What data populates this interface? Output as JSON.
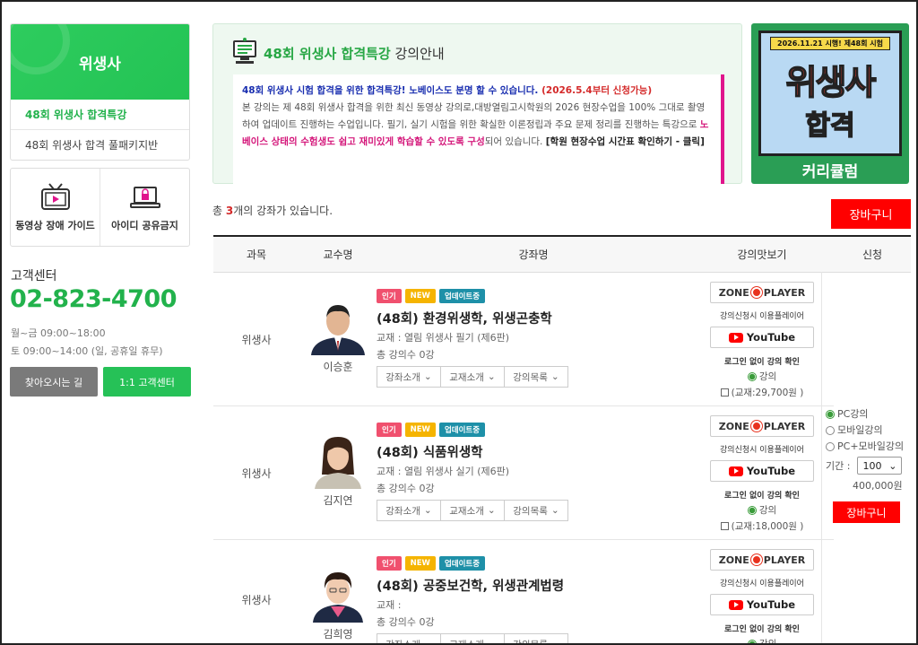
{
  "sidebar": {
    "title": "위생사",
    "links": [
      "48회 위생사 합격특강",
      "48회 위생사 합격 풀패키지반"
    ],
    "guides": [
      "동영상 장애 가이드",
      "아이디 공유금지"
    ]
  },
  "customer_center": {
    "title": "고객센터",
    "phone": "02-823-4700",
    "hours_weekday": "월~금 09:00~18:00",
    "hours_saturday": "토 09:00~14:00 (일, 공휴일 휴무)",
    "btn_directions": "찾아오시는 길",
    "btn_1on1": "1:1 고객센터"
  },
  "notice": {
    "title_green": "48회 위생사 합격특강",
    "title_rest": " 강의안내",
    "line_blue": "48회 위생사 시험 합격을 위한 합격특강! 노베이스도 분명 할 수 있습니다.",
    "line_red": " (2026.5.4부터 신청가능)",
    "body_1": "본 강의는 제 48회 위생사 합격을 위한 최신 동영상 강의로,대방열림고시학원의 2026 현장수업을 100% 그대로 촬영하여 업데이트 진행하는 수업입니다. 필기, 실기 시험을 위한 확실한 이론정립과 주요 문제 정리를 진행하는 특강으로 ",
    "body_pink": "노베이스 상태의 수험생도 쉽고 재미있게 학습할 수 있도록 구성",
    "body_2": "되어 있습니다. ",
    "body_link": "[학원 현장수업 시간표 확인하기 - 클릭]"
  },
  "banner": {
    "date": "2026.11.21 시행! 제48회 시험",
    "title": "위생사",
    "subtitle": "합격",
    "footer": "커리큘럼"
  },
  "listing": {
    "count_prefix": "총 ",
    "count": "3",
    "count_suffix": "개의 강좌가 있습니다.",
    "cart_label": "장바구니"
  },
  "table": {
    "headers": [
      "과목",
      "교수명",
      "강좌명",
      "강의맛보기",
      "신청"
    ]
  },
  "common": {
    "badges": [
      "인기",
      "NEW",
      "업데이트중"
    ],
    "mini_buttons": [
      "강좌소개",
      "교재소개",
      "강의목록"
    ],
    "zone_player": "ZONE",
    "zone_player2": "PLAYER",
    "player_note": "강의신청시 이용플레이어",
    "youtube": "YouTube",
    "login_note": "로그인 없이 강의 확인",
    "radio_label": "강의",
    "total_label": "총 강의수 0강"
  },
  "courses": [
    {
      "subject": "위생사",
      "professor": "이승훈",
      "title": "(48회) 환경위생학, 위생곤충학",
      "book": "교재 : 열림 위생사 필기 (제6판)",
      "book_price": "(교재:29,700원 )"
    },
    {
      "subject": "위생사",
      "professor": "김지연",
      "title": "(48회) 식품위생학",
      "book": "교재 : 열림 위생사 실기 (제6판)",
      "book_price": "(교재:18,000원 )"
    },
    {
      "subject": "위생사",
      "professor": "김희영",
      "title": "(48회) 공중보건학, 위생관계법령",
      "book": "교재 :",
      "book_price": ""
    }
  ],
  "apply": {
    "options": [
      "PC강의",
      "모바일강의",
      "PC+모바일강의"
    ],
    "period_label": "기간 :",
    "period_value": "100",
    "price": "400,000원",
    "cart": "장바구니"
  },
  "colors": {
    "green": "#22b24c",
    "red": "#ff0000",
    "pink": "#d4167a"
  }
}
